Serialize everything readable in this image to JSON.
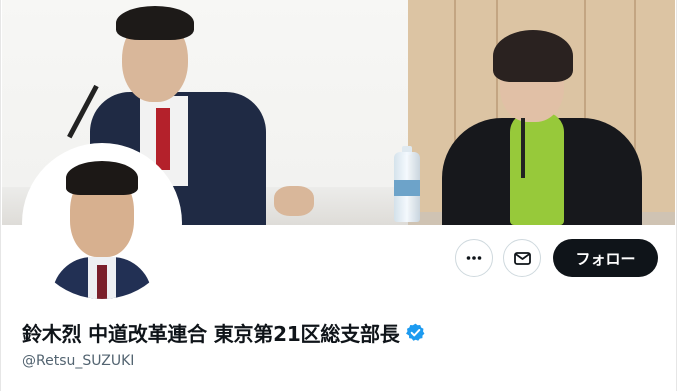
{
  "profile": {
    "display_name": "鈴木烈 中道改革連合 東京第21区総支部長",
    "handle": "@Retsu_SUZUKI",
    "verified": true
  },
  "actions": {
    "more_icon": "more-horizontal-icon",
    "message_icon": "envelope-icon",
    "follow_label": "フォロー"
  },
  "colors": {
    "follow_bg": "#0f1419",
    "verified_badge": "#1d9bf0",
    "handle_text": "#536471"
  }
}
